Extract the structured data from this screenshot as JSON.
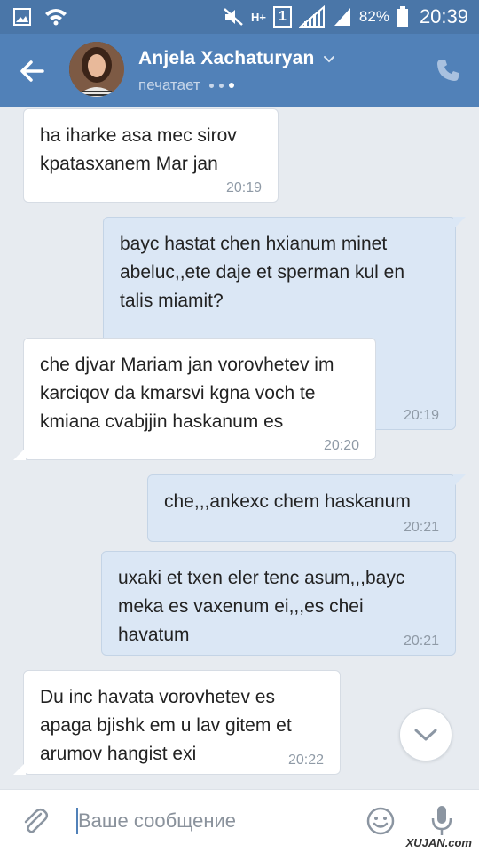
{
  "status_bar": {
    "network_type": "H+",
    "sim_slot": "1",
    "battery_percent": "82%",
    "time": "20:39"
  },
  "header": {
    "contact_name": "Anjela Xachaturyan",
    "status": "печатает"
  },
  "messages": [
    {
      "direction": "in",
      "text": "ha iharke asa mec sirov kpatasxanem Mar jan",
      "time": "20:19"
    },
    {
      "direction": "out",
      "text": "bayc hastat chen hxianum minet abeluc,,ete daje et sperman kul en talis miamit?",
      "time": "20:19"
    },
    {
      "direction": "in",
      "text": "che djvar Mariam jan vorovhetev im karciqov da kmarsvi kgna voch te kmiana cvabjjin haskanum es",
      "time": "20:20"
    },
    {
      "direction": "out",
      "text": "che,,,ankexc chem haskanum",
      "time": "20:21"
    },
    {
      "direction": "out",
      "text": "uxaki et txen eler tenc asum,,,bayc meka es vaxenum ei,,,es chei havatum",
      "time": "20:21"
    },
    {
      "direction": "in",
      "text": "Du inc havata vorovhetev es apaga bjishk em u lav gitem et arumov hangist exi",
      "time": "20:22"
    }
  ],
  "composer": {
    "placeholder": "Ваше сообщение"
  },
  "watermark": "XUJAN.com",
  "colors": {
    "status_bar": "#4a76a8",
    "toolbar": "#5181b8",
    "chat_background": "#e7ebf0",
    "incoming_bubble": "#ffffff",
    "outgoing_bubble": "#dbe7f5"
  },
  "icons": [
    "image-icon",
    "wifi-icon",
    "mute-icon",
    "signal-icon",
    "battery-icon",
    "back-arrow-icon",
    "chevron-down-icon",
    "phone-icon",
    "scroll-down-icon",
    "paperclip-icon",
    "emoji-icon",
    "microphone-icon"
  ]
}
